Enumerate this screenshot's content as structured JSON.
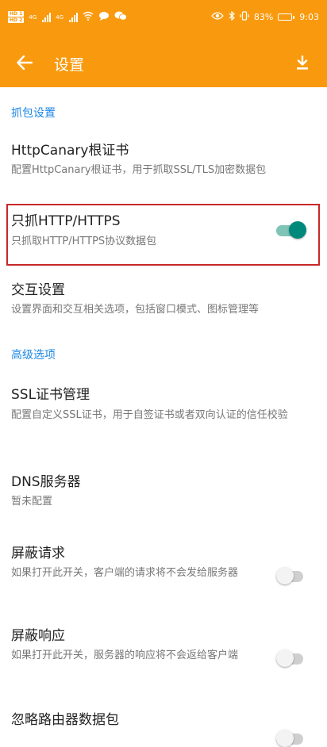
{
  "status_bar": {
    "sim1": "HD 1",
    "sim2": "HD 2",
    "net1": "4G",
    "net2": "4G",
    "battery_level": "83%",
    "time": "9:03",
    "icons": [
      "eye-icon",
      "bluetooth-icon",
      "vibrate-icon",
      "battery-icon"
    ]
  },
  "toolbar": {
    "title": "设置",
    "back_icon": "arrow-left-icon",
    "download_icon": "download-icon"
  },
  "colors": {
    "appbar": "#f99a0e",
    "accent": "#00897b",
    "section": "#1e88e5",
    "highlight": "#c62828"
  },
  "sections": {
    "capture": "抓包设置",
    "advanced": "高级选项"
  },
  "items": {
    "root_cert": {
      "title": "HttpCanary根证书",
      "sub": "配置HttpCanary根证书，用于抓取SSL/TLS加密数据包"
    },
    "http_only": {
      "title": "只抓HTTP/HTTPS",
      "sub": "只抓取HTTP/HTTPS协议数据包",
      "enabled": true
    },
    "interaction": {
      "title": "交互设置",
      "sub": "设置界面和交互相关选项，包括窗口模式、图标管理等"
    },
    "ssl_cert": {
      "title": "SSL证书管理",
      "sub": "配置自定义SSL证书，用于自签证书或者双向认证的信任校验"
    },
    "dns": {
      "title": "DNS服务器",
      "sub": "暂未配置"
    },
    "block_request": {
      "title": "屏蔽请求",
      "sub": "如果打开此开关，客户端的请求将不会发给服务器",
      "enabled": false
    },
    "block_response": {
      "title": "屏蔽响应",
      "sub": "如果打开此开关，服务器的响应将不会返给客户端",
      "enabled": false
    },
    "ignore_router": {
      "title": "忽略路由器数据包",
      "enabled": false
    }
  }
}
